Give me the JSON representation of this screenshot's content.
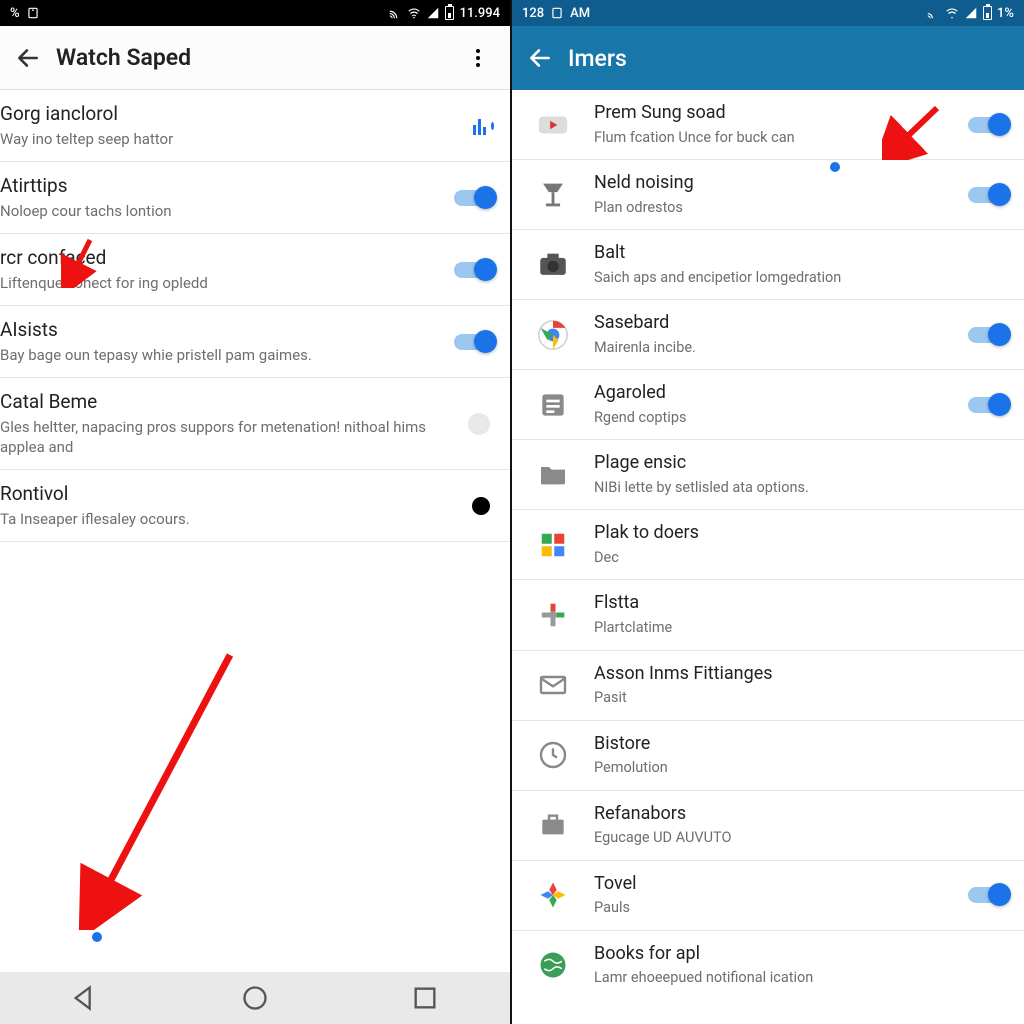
{
  "left": {
    "statusbar": {
      "left_text": "%",
      "right_text": "11.994"
    },
    "toolbar": {
      "title": "Watch Saped"
    },
    "items": [
      {
        "title": "Gorg ianclorol",
        "subtitle": "Way ino teltep seep hattor",
        "ctrl": "eq"
      },
      {
        "title": "Atirttips",
        "subtitle": "Noloep cour tachs lontion",
        "ctrl": "switch_on"
      },
      {
        "title": "rcr confaced",
        "subtitle": "Liftenque conect for ing opledd",
        "ctrl": "switch_on"
      },
      {
        "title": "AIsists",
        "subtitle": "Bay bage oun tepasy whie pristell pam gaimes.",
        "ctrl": "switch_on"
      },
      {
        "title": "Catal Beme",
        "subtitle": "Gles heltter, napacing pros suppors for metenation! nithoal hims applea and",
        "ctrl": "info"
      },
      {
        "title": "Rontivol",
        "subtitle": "Ta Inseaper iflesaley ocours.",
        "ctrl": "black"
      }
    ]
  },
  "right": {
    "statusbar": {
      "left_text": "128",
      "left_text2": "AM",
      "right_text": "1%"
    },
    "toolbar": {
      "title": "Imers"
    },
    "items": [
      {
        "icon": "youtube",
        "title": "Prem Sung soad",
        "subtitle": "Flum fcation Unce for buck can",
        "ctrl": "switch_on"
      },
      {
        "icon": "lamp",
        "title": "Neld noising",
        "subtitle": "Plan odrestos",
        "ctrl": "switch_on"
      },
      {
        "icon": "camera",
        "title": "Balt",
        "subtitle": "Saich aps and encipetior lomgedration",
        "ctrl": "none"
      },
      {
        "icon": "chrome",
        "title": "Sasebard",
        "subtitle": "Mairenla incibe.",
        "ctrl": "switch_on"
      },
      {
        "icon": "news",
        "title": "Agaroled",
        "subtitle": "Rgend coptips",
        "ctrl": "switch_on"
      },
      {
        "icon": "folder",
        "title": "Plage ensic",
        "subtitle": "NIBi lette by setlisled ata options.",
        "ctrl": "none"
      },
      {
        "icon": "grid",
        "title": "Plak to doers",
        "subtitle": "Dec",
        "ctrl": "none"
      },
      {
        "icon": "plus",
        "title": "Flstta",
        "subtitle": "Plartclatime",
        "ctrl": "none"
      },
      {
        "icon": "mail",
        "title": "Asson Inms Fittianges",
        "subtitle": "Pasit",
        "ctrl": "none"
      },
      {
        "icon": "clock",
        "title": "Bistore",
        "subtitle": "Pemolution",
        "ctrl": "none"
      },
      {
        "icon": "briefcase",
        "title": "Refanabors",
        "subtitle": "Egucage UD AUVUTO",
        "ctrl": "none"
      },
      {
        "icon": "photos",
        "title": "Tovel",
        "subtitle": "Pauls",
        "ctrl": "switch_on"
      },
      {
        "icon": "globe",
        "title": "Books for apl",
        "subtitle": "Lamr ehoeepued notifional ication",
        "ctrl": "none"
      }
    ]
  }
}
